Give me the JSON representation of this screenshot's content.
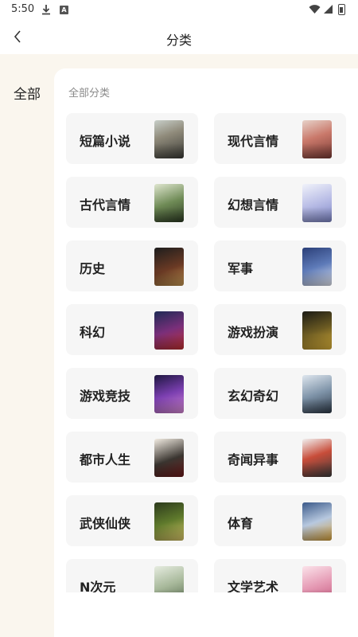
{
  "status_bar": {
    "time": "5:50",
    "icons": [
      "download-icon",
      "a-badge-icon",
      "wifi-icon",
      "signal-icon",
      "battery-icon"
    ]
  },
  "header": {
    "title": "分类",
    "back_icon": "chevron-left-icon"
  },
  "sidebar": {
    "items": [
      {
        "label": "全部",
        "selected": true
      }
    ]
  },
  "content": {
    "section_title": "全部分类",
    "categories": [
      {
        "label": "短篇小说",
        "cover_icon": "book-cover"
      },
      {
        "label": "现代言情",
        "cover_icon": "book-cover"
      },
      {
        "label": "古代言情",
        "cover_icon": "book-cover"
      },
      {
        "label": "幻想言情",
        "cover_icon": "book-cover"
      },
      {
        "label": "历史",
        "cover_icon": "book-cover"
      },
      {
        "label": "军事",
        "cover_icon": "book-cover"
      },
      {
        "label": "科幻",
        "cover_icon": "book-cover"
      },
      {
        "label": "游戏扮演",
        "cover_icon": "book-cover"
      },
      {
        "label": "游戏竞技",
        "cover_icon": "book-cover"
      },
      {
        "label": "玄幻奇幻",
        "cover_icon": "book-cover"
      },
      {
        "label": "都市人生",
        "cover_icon": "book-cover"
      },
      {
        "label": "奇闻异事",
        "cover_icon": "book-cover"
      },
      {
        "label": "武侠仙侠",
        "cover_icon": "book-cover"
      },
      {
        "label": "体育",
        "cover_icon": "book-cover"
      },
      {
        "label": "N次元",
        "cover_icon": "book-cover"
      },
      {
        "label": "文学艺术",
        "cover_icon": "book-cover"
      }
    ]
  },
  "colors": {
    "page_background": "#faf6ee",
    "card_background": "#f6f6f6",
    "section_title": "#8a8a8a",
    "text": "#222222"
  }
}
